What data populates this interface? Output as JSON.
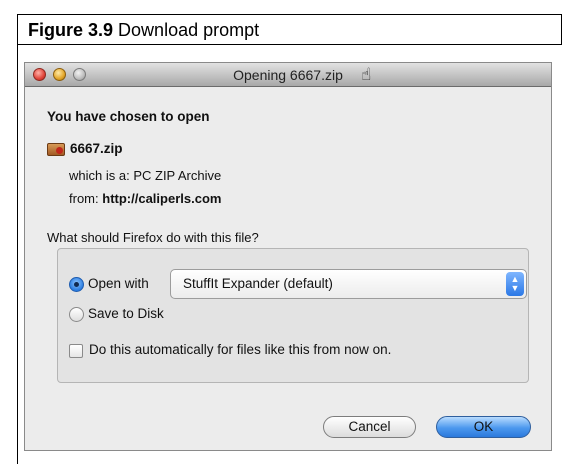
{
  "caption": {
    "label": "Figure 3.9",
    "text": "Download prompt"
  },
  "window": {
    "title": "Opening 6667.zip"
  },
  "dialog": {
    "heading": "You have chosen to open",
    "file_name": "6667.zip",
    "type_prefix": "which is a:",
    "type_value": "PC ZIP Archive",
    "from_prefix": "from:",
    "from_value": "http://caliperls.com",
    "question": "What should Firefox do with this file?",
    "open_with_label": "Open with",
    "open_with_selected": true,
    "open_with_app": "StuffIt Expander (default)",
    "save_to_disk_label": "Save to Disk",
    "save_to_disk_selected": false,
    "auto_label": "Do this automatically for files like this from now on.",
    "auto_checked": false,
    "cancel_label": "Cancel",
    "ok_label": "OK"
  },
  "icons": [
    "close-icon",
    "minimize-icon",
    "zoom-icon",
    "hand-cursor-icon",
    "zip-archive-icon",
    "chevron-updown-icon"
  ]
}
